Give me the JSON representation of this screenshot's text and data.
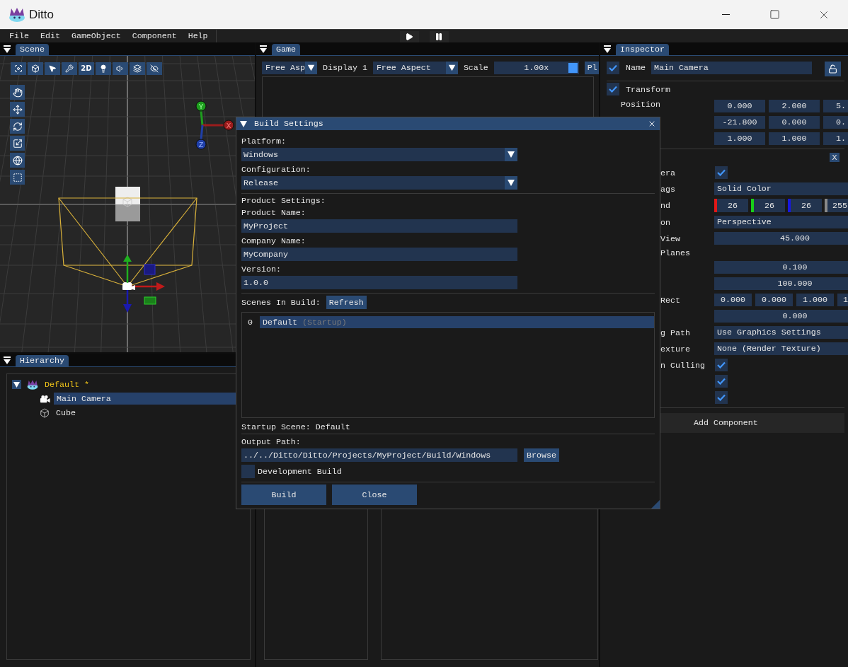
{
  "window": {
    "title": "Ditto"
  },
  "menu_bar": {
    "items": [
      "File",
      "Edit",
      "GameObject",
      "Component",
      "Help"
    ]
  },
  "scene_panel": {
    "tab": "Scene",
    "mode_button": "2D",
    "axis_handles": [
      {
        "label": "Y",
        "color": "#1e9e1e"
      },
      {
        "label": "X",
        "color": "#9a1c1c"
      },
      {
        "label": "Z",
        "color": "#1f3fa8"
      }
    ]
  },
  "hierarchy": {
    "tab": "Hierarchy",
    "tree": [
      {
        "name": "Default *",
        "kind": "scene",
        "expanded": true,
        "selected": false,
        "children": [
          {
            "name": "Main Camera",
            "kind": "camera",
            "selected": true
          },
          {
            "name": "Cube",
            "kind": "mesh",
            "selected": false
          }
        ]
      }
    ]
  },
  "game_panel": {
    "tab": "Game",
    "aspect_short": "Free Asp",
    "display": "Display 1",
    "aspect": "Free Aspect",
    "scale": {
      "label": "Scale",
      "value": "1.00x",
      "level": 1
    },
    "button": "Pl"
  },
  "inspector": {
    "tab": "Inspector",
    "object": {
      "active": true,
      "label": "Name",
      "value": "Main Camera"
    },
    "transform": {
      "enabled": true,
      "title": "Transform",
      "rows": [
        {
          "label": "Position",
          "values": [
            "0.000",
            "2.000",
            "5."
          ]
        },
        {
          "values": [
            "-21.800",
            "0.000",
            "0."
          ]
        },
        {
          "values": [
            "1.000",
            "1.000",
            "1."
          ]
        }
      ]
    },
    "camera": {
      "remove_button": "X",
      "rows": [
        {
          "label": "era",
          "kind": "checkbox",
          "checked": true
        },
        {
          "label": "ags",
          "kind": "dropdown",
          "value": "Solid Color"
        },
        {
          "label": "nd",
          "kind": "color",
          "channels": [
            {
              "value": "26",
              "color": "#e01818"
            },
            {
              "value": "26",
              "color": "#18d018"
            },
            {
              "value": "26",
              "color": "#1818e0"
            },
            {
              "value": "255",
              "color": "#8a8a8a"
            }
          ]
        },
        {
          "label": "on",
          "kind": "dropdown",
          "value": "Perspective"
        },
        {
          "label": "View",
          "kind": "number",
          "value": "45.000"
        },
        {
          "label": "Planes",
          "kind": "heading"
        },
        {
          "kind": "number",
          "value": "0.100"
        },
        {
          "kind": "number",
          "value": "100.000"
        },
        {
          "label": "Rect",
          "kind": "vector",
          "values": [
            "0.000",
            "0.000",
            "1.000",
            "1"
          ]
        },
        {
          "kind": "number",
          "value": "0.000"
        },
        {
          "label": "g Path",
          "kind": "dropdown",
          "value": "Use Graphics Settings"
        },
        {
          "label": "exture",
          "kind": "dropdown",
          "value": "None (Render Texture)"
        },
        {
          "label": "n Culling",
          "kind": "checkbox",
          "checked": true
        },
        {
          "kind": "checkbox",
          "checked": true
        },
        {
          "kind": "checkbox",
          "checked": true
        }
      ]
    },
    "add_component": "Add Component"
  },
  "build_settings": {
    "title": "Build Settings",
    "platform": {
      "label": "Platform:",
      "value": "Windows"
    },
    "configuration": {
      "label": "Configuration:",
      "value": "Release"
    },
    "product_settings": {
      "heading": "Product Settings:",
      "fields": [
        {
          "label": "Product Name:",
          "value": "MyProject"
        },
        {
          "label": "Company Name:",
          "value": "MyCompany"
        },
        {
          "label": "Version:",
          "value": "1.0.0"
        }
      ]
    },
    "scenes_in_build": {
      "label": "Scenes In Build:",
      "refresh_button": "Refresh",
      "items": [
        {
          "index": "0",
          "name": "Default",
          "note": "(Startup)",
          "selected": true
        }
      ]
    },
    "startup_scene": "Startup Scene: Default",
    "output_path": {
      "label": "Output Path:",
      "value": "../../Ditto/Ditto/Projects/MyProject/Build/Windows",
      "browse_button": "Browse"
    },
    "development_build": {
      "label": "Development Build",
      "checked": false
    },
    "buttons": [
      "Build",
      "Close"
    ]
  }
}
